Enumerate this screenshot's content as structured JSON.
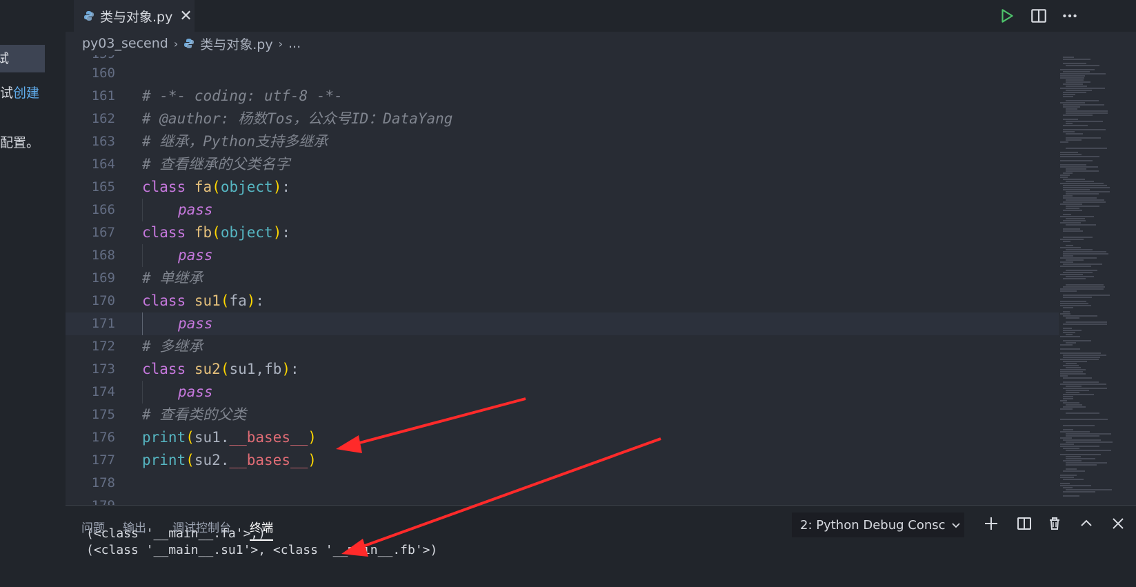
{
  "sidebar": {
    "line1": "试",
    "line2_prefix": "调试",
    "line2_link": "创建",
    "line3": "置配置。"
  },
  "tab": {
    "label": "类与对象.py",
    "close": "✕"
  },
  "breadcrumb": {
    "folder": "py03_secend",
    "file": "类与对象.py",
    "more": "..."
  },
  "editor": {
    "partial_top": "159",
    "partial_bottom": "179",
    "line_numbers": [
      "160",
      "161",
      "162",
      "163",
      "164",
      "165",
      "166",
      "167",
      "168",
      "169",
      "170",
      "171",
      "172",
      "173",
      "174",
      "175",
      "176",
      "177",
      "178"
    ],
    "comments": {
      "l161": "# -*- coding: utf-8 -*-",
      "l162": "# @author: 杨数Tos，公众号ID：DataYang",
      "l163": "# 继承，Python支持多继承",
      "l164": "# 查看继承的父类名字",
      "l169": "# 单继承",
      "l172": "# 多继承",
      "l175": "# 查看类的父类"
    },
    "kw_class": "class",
    "kw_pass": "pass",
    "names": {
      "fa": "fa",
      "fb": "fb",
      "su1": "su1",
      "su2": "su2",
      "object": "object",
      "print": "print",
      "bases": "__bases__"
    }
  },
  "panel": {
    "tabs": [
      "问题",
      "输出",
      "调试控制台",
      "终端"
    ],
    "active_tab": "终端",
    "terminal_select": "2: Python Debug Consc",
    "output": [
      "(<class '__main__.fa'>,)",
      "(<class '__main__.su1'>, <class '__main__.fb'>)"
    ]
  },
  "colors": {
    "accent_arrow": "#ff2a2a",
    "run_icon": "#4ec36b"
  }
}
